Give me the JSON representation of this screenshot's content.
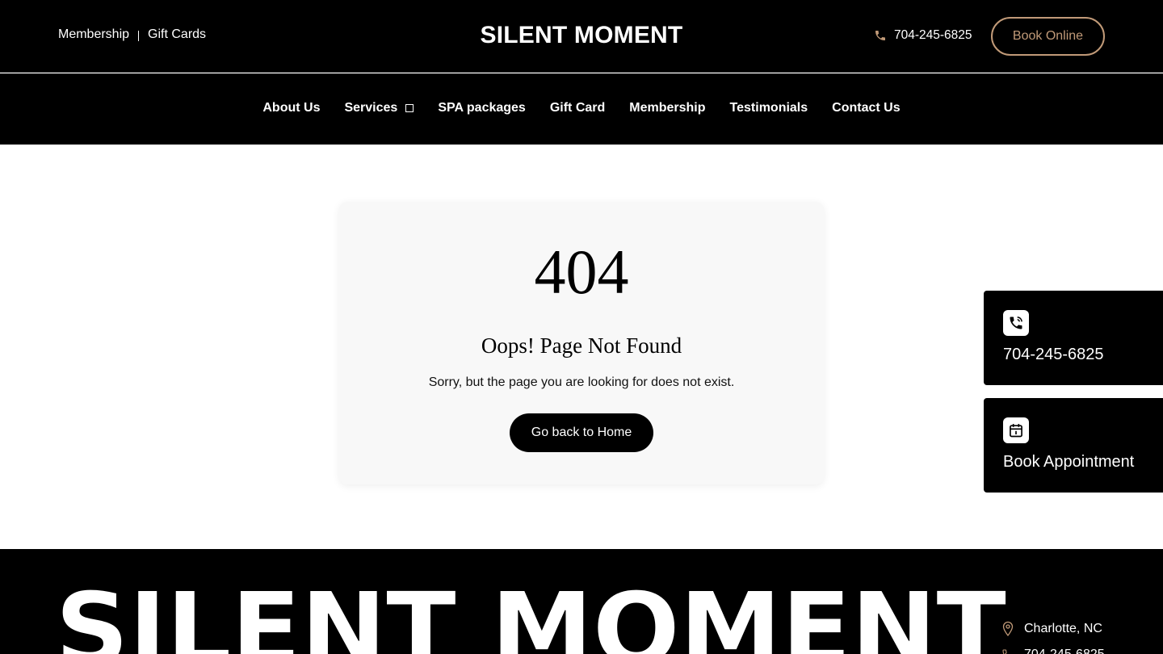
{
  "header": {
    "top_links": [
      "Membership",
      "Gift Cards"
    ],
    "logo": "SILENT MOMENT",
    "phone": "704-245-6825",
    "book_label": "Book Online"
  },
  "nav": {
    "items": [
      "About Us",
      "Services",
      "SPA packages",
      "Gift Card",
      "Membership",
      "Testimonials",
      "Contact Us"
    ]
  },
  "error": {
    "code": "404",
    "title": "Oops! Page Not Found",
    "message": "Sorry, but the page you are looking for does not exist.",
    "button": "Go back to Home"
  },
  "side_widgets": {
    "call_label": "704-245-6825",
    "book_label": "Book Appointment",
    "call_icon": "phone-call-icon",
    "book_icon": "calendar-icon"
  },
  "footer": {
    "big_logo": "SILENT MOMENT",
    "location": "Charlotte, NC",
    "phone": "704-245-6825"
  },
  "colors": {
    "accent": "#c19a78",
    "background_dark": "#000000",
    "card_bg": "#f8f8f8"
  }
}
